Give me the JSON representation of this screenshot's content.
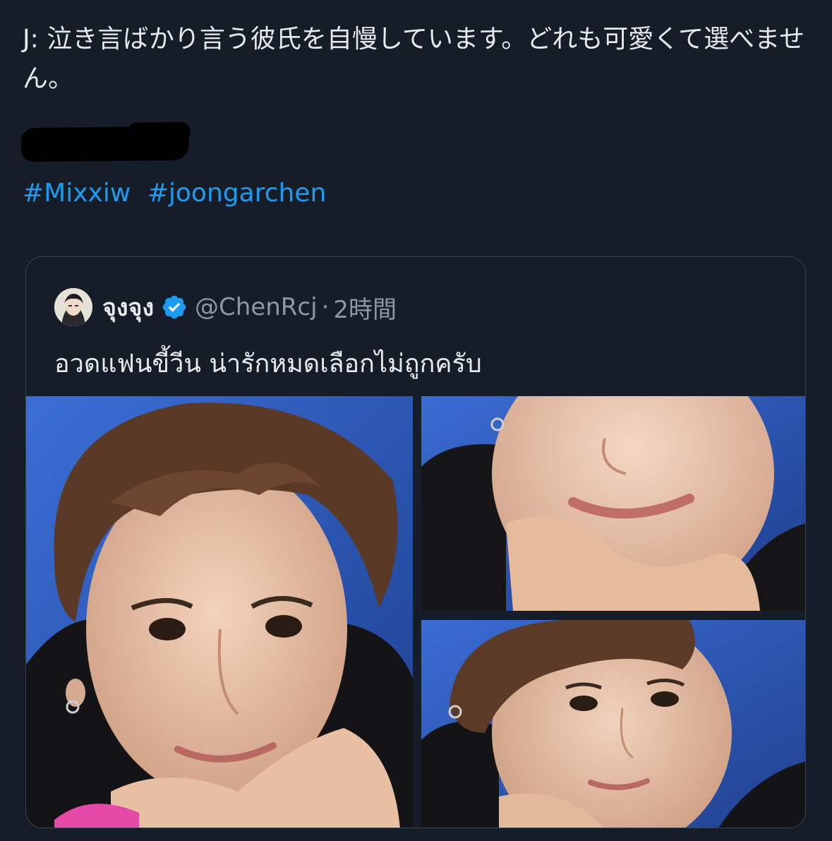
{
  "tweet": {
    "text": "J: 泣き言ばかり言う彼氏を自慢しています。どれも可愛くて選べません。",
    "hashtags": [
      "#Mixxiw",
      "#joongarchen"
    ]
  },
  "quoted_tweet": {
    "display_name": "จุงจุง",
    "verified": true,
    "handle": "@ChenRcj",
    "separator": "·",
    "time": "2時間",
    "text": "อวดแฟนขี้วีน น่ารักหมดเลือกไม่ถูกครับ",
    "media": [
      {
        "id": "photo-1",
        "description": "selfie"
      },
      {
        "id": "photo-2",
        "description": "selfie"
      },
      {
        "id": "photo-3",
        "description": "selfie"
      }
    ]
  },
  "colors": {
    "background": "#151d28",
    "text": "#e7e9ea",
    "secondary_text": "#8b98a5",
    "hashtag": "#1d9bf0",
    "border": "#38444d",
    "verified_badge": "#1d9bf0"
  },
  "icons": {
    "verified": "verified-badge-icon"
  }
}
